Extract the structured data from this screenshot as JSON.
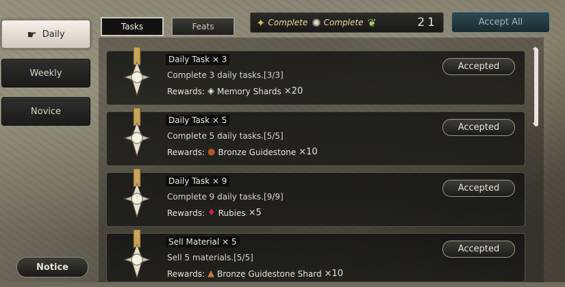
{
  "sidebar": {
    "items": [
      {
        "label": "Daily",
        "active": true
      },
      {
        "label": "Weekly",
        "active": false
      },
      {
        "label": "Novice",
        "active": false
      }
    ],
    "notice_label": "Notice"
  },
  "tabs": [
    {
      "label": "Tasks",
      "active": true
    },
    {
      "label": "Feats",
      "active": false
    }
  ],
  "progress": {
    "complete_label_1": "Complete",
    "complete_label_2": "Complete",
    "count": "21"
  },
  "accept_all_label": "Accept All",
  "tasks": [
    {
      "title": "Daily Task × 3",
      "desc": "Complete 3 daily tasks.[3/3]",
      "reward_label": "Rewards:",
      "reward_icon": "memory-shard-icon",
      "reward_name": "Memory Shards",
      "reward_qty": "×20",
      "button": "Accepted"
    },
    {
      "title": "Daily Task × 5",
      "desc": "Complete 5 daily tasks.[5/5]",
      "reward_label": "Rewards:",
      "reward_icon": "bronze-guidestone-icon",
      "reward_name": "Bronze Guidestone",
      "reward_qty": "×10",
      "button": "Accepted"
    },
    {
      "title": "Daily Task × 9",
      "desc": "Complete 9 daily tasks.[9/9]",
      "reward_label": "Rewards:",
      "reward_icon": "ruby-icon",
      "reward_name": "Rubies",
      "reward_qty": "×5",
      "button": "Accepted"
    },
    {
      "title": "Sell Material × 5",
      "desc": "Sell 5 materials.[5/5]",
      "reward_label": "Rewards:",
      "reward_icon": "bronze-guidestone-shard-icon",
      "reward_name": "Bronze Guidestone Shard",
      "reward_qty": "×10",
      "button": "Accepted"
    }
  ],
  "colors": {
    "accent_gold": "#d9b95b",
    "ruby": "#d0234a",
    "guidestone": "#b4542a",
    "accept_all_bg": "#2f4a52"
  }
}
